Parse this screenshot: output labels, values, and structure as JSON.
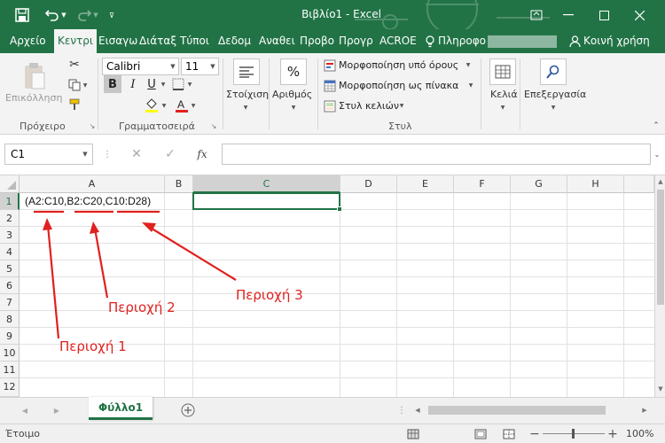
{
  "window": {
    "title": "Βιβλίο1 - Excel"
  },
  "tabs": [
    "Αρχείο",
    "Κεντρι",
    "Εισαγω",
    "Διάταξ",
    "Τύποι",
    "Δεδομ",
    "Αναθει",
    "Προβο",
    "Προγρ",
    "ACROE"
  ],
  "tell_me": "Πληροφο",
  "share": "Κοινή χρήση",
  "ribbon": {
    "paste": "Επικόλληση",
    "clipboard": "Πρόχειρο",
    "font_name": "Calibri",
    "font_size": "11",
    "font_group": "Γραμματοσειρά",
    "alignment": "Στοίχιση",
    "number": "Αριθμός",
    "cond_format": "Μορφοποίηση υπό όρους",
    "table_format": "Μορφοποίηση ως πίνακα",
    "cell_styles": "Στυλ κελιών",
    "styles_group": "Στυλ",
    "cells": "Κελιά",
    "editing": "Επεξεργασία"
  },
  "formula_bar": {
    "name_box": "C1",
    "fx": "fx",
    "content": ""
  },
  "grid": {
    "columns": [
      "A",
      "B",
      "C",
      "D",
      "E",
      "F",
      "G",
      "H"
    ],
    "rows": [
      "1",
      "2",
      "3",
      "4",
      "5",
      "6",
      "7",
      "8",
      "9",
      "10",
      "11",
      "12"
    ],
    "a1": "(A2:C10,B2:C20,C10:D28)"
  },
  "annotations": {
    "r1": "Περιοχή 1",
    "r2": "Περιοχή 2",
    "r3": "Περιοχή 3"
  },
  "sheet_tab": "Φύλλο1",
  "status": {
    "ready": "Έτοιμο",
    "zoom": "100%"
  },
  "colors": {
    "brand": "#217346",
    "annotation": "#e0211f"
  }
}
